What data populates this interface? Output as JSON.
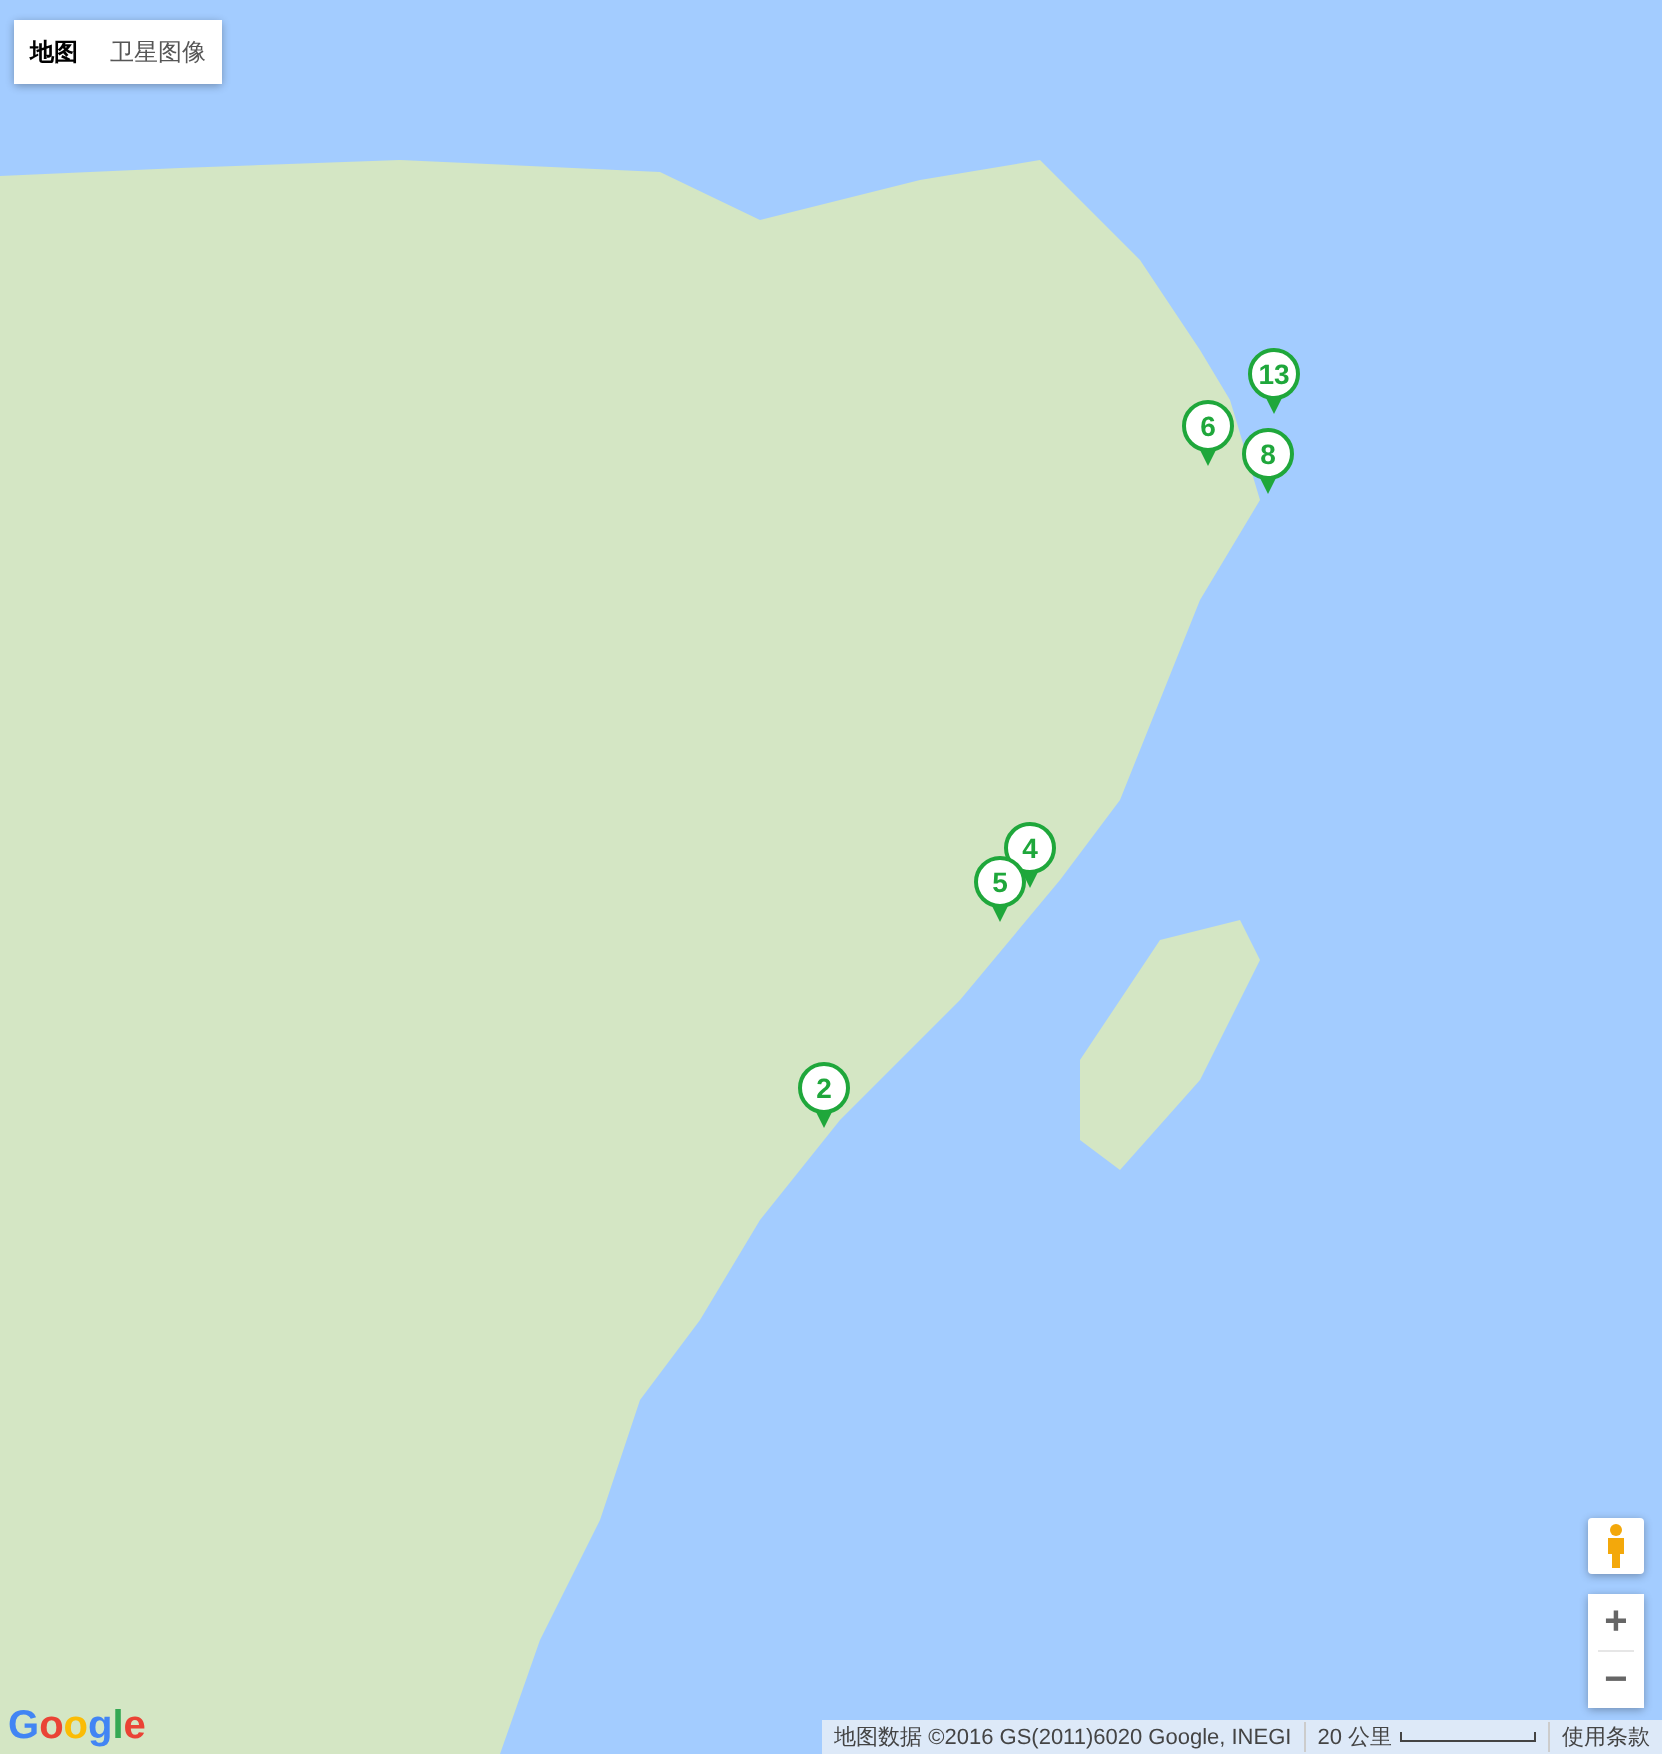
{
  "map_type_tabs": [
    {
      "label": "地图",
      "selected": true
    },
    {
      "label": "卫星图像",
      "selected": false
    }
  ],
  "markers": [
    {
      "label": "13"
    },
    {
      "label": "6"
    },
    {
      "label": "8"
    },
    {
      "label": "4"
    },
    {
      "label": "5"
    },
    {
      "label": "2"
    }
  ],
  "zoom_controls": {
    "zoom_in": "+",
    "zoom_out": "−"
  },
  "logo": "Google",
  "footer": {
    "attribution": "地图数据 ©2016 GS(2011)6020 Google, INEGI",
    "scale": "20 公里",
    "terms": "使用条款"
  }
}
